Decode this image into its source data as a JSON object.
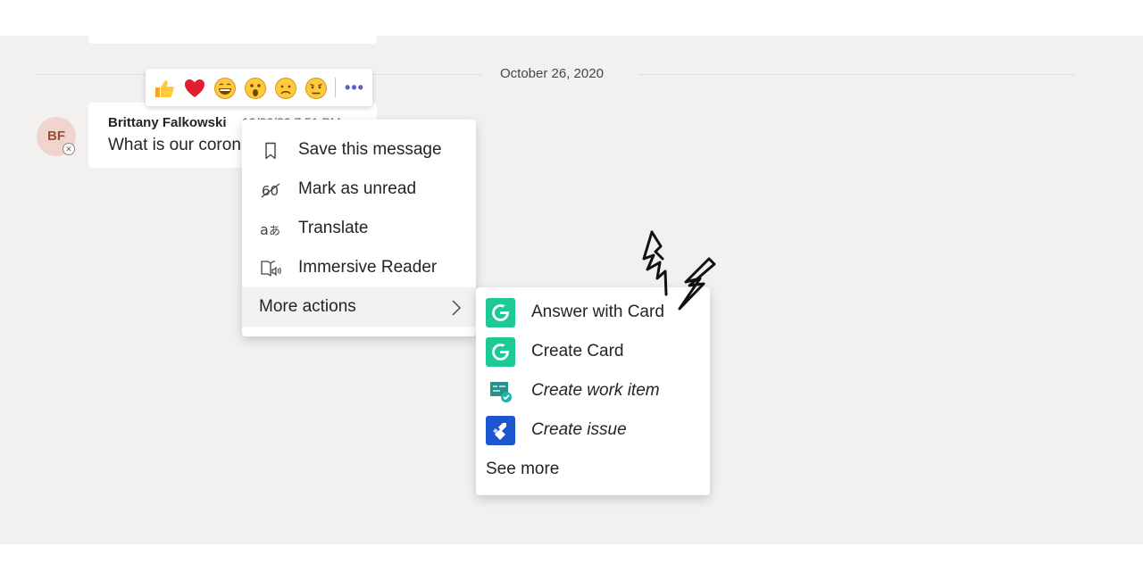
{
  "date_divider": "October 26, 2020",
  "message": {
    "avatar_initials": "BF",
    "author": "Brittany Falkowski",
    "time": "10/26/20 7:51 PM",
    "text": "What is our coron"
  },
  "reactions": [
    "like",
    "heart",
    "laugh",
    "surprised",
    "sad",
    "angry"
  ],
  "reactions_more": "•••",
  "context_menu": {
    "items": [
      {
        "label": "Save this message",
        "icon": "bookmark-icon"
      },
      {
        "label": "Mark as unread",
        "icon": "mark-unread-icon"
      },
      {
        "label": "Translate",
        "icon": "translate-icon"
      },
      {
        "label": "Immersive Reader",
        "icon": "immersive-reader-icon"
      }
    ],
    "more_actions": "More actions"
  },
  "submenu": {
    "items": [
      {
        "label": "Answer with Card",
        "icon": "guru-icon"
      },
      {
        "label": "Create Card",
        "icon": "guru-icon"
      },
      {
        "label": "Create work item",
        "icon": "work-item-icon"
      },
      {
        "label": "Create issue",
        "icon": "jira-icon"
      }
    ],
    "see_more": "See more"
  },
  "colors": {
    "guru": "#1ec996",
    "jira": "#1e56d0",
    "work_item": "#2b8f8a",
    "accent": "#5b5fc7"
  }
}
